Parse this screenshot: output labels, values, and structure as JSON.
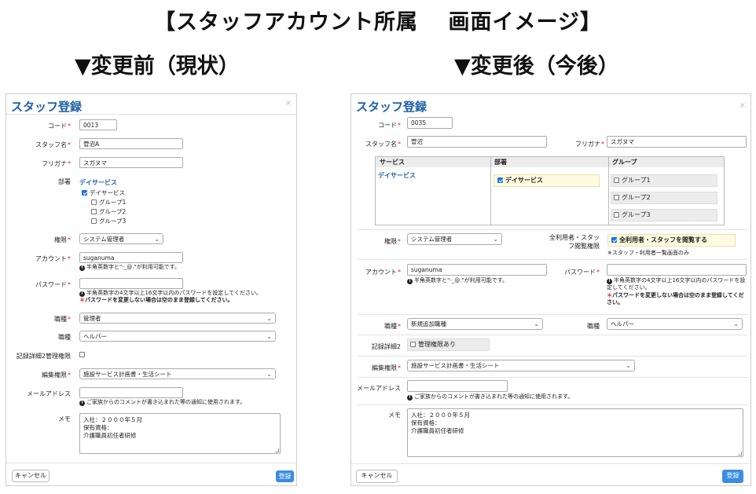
{
  "heading": {
    "title": "【スタッフアカウント所属　 画面イメージ】",
    "before": "▼変更前（現状）",
    "after": "▼変更後（今後）"
  },
  "required_mark": "*",
  "before": {
    "title": "スタッフ登録",
    "close": "×",
    "code_label": "コード",
    "code_value": "0013",
    "name_label": "スタッフ名",
    "name_value": "菅沼A",
    "kana_label": "フリガナ",
    "kana_value": "スガヌマ",
    "dept_label": "部署",
    "dept_link": "デイサービス",
    "dept_check": "デイサービス",
    "groups": [
      "グループ1",
      "グループ2",
      "グループ3"
    ],
    "authority_label": "権限",
    "authority_value": "システム管理者",
    "account_label": "アカウント",
    "account_value": "suganuma",
    "account_note": "半角英数字と\"-_@.\"が利用可能です。",
    "password_label": "パスワード",
    "password_note": "半角英数字の4文字以上16文字以内のパスワードを設定してください。",
    "password_warn": "パスワードを変更しない場合は空のまま登録してください。",
    "job_label": "職種",
    "job_value": "管理者",
    "job2_label": "職種",
    "job2_value": "ヘルパー",
    "record_label": "記録詳細2管理権限",
    "edit_label": "編集権限",
    "edit_value": "施設サービス計画書・生活シート",
    "mail_label": "メールアドレス",
    "mail_note": "ご家族からのコメントが書き込まれた等の通知に使用されます。",
    "memo_label": "メモ",
    "memo_lines": [
      "入社：２０００年５月",
      "保有資格：",
      "介護職員初任者研修"
    ],
    "cancel": "キャンセル",
    "submit": "登録"
  },
  "after": {
    "title": "スタッフ登録",
    "close": "×",
    "code_label": "コード",
    "code_value": "0035",
    "name_label": "スタッフ名",
    "name_value": "菅沼",
    "kana_label": "フリガナ",
    "kana_value": "スガヌマ",
    "table_headers": [
      "サービス",
      "部署",
      "グループ"
    ],
    "service_link": "デイサービス",
    "dept_check": "デイサービス",
    "groups": [
      "グループ1",
      "グループ2",
      "グループ3"
    ],
    "authority_label": "権限",
    "authority_value": "システム管理者",
    "all_users_label": "全利用者・スタッフ閲覧権限",
    "all_users_check": "全利用者・スタッフを閲覧する",
    "all_users_note": "※スタッフ・利用者一覧画面のみ",
    "account_label": "アカウント",
    "account_value": "suganuma",
    "account_note": "半角英数字と\"-_@.\"が利用可能です。",
    "password_label": "パスワード",
    "password_note": "半角英数字の4文字以上16文字以内のパスワードを設定してください。",
    "password_warn": "パスワードを変更しない場合は空のまま登録してください。",
    "job_label": "職種",
    "job_value": "新規追加職種",
    "job2_label": "職種",
    "job2_value": "ヘルパー",
    "record_label": "記録詳細2",
    "record_check": "管理権限あり",
    "edit_label": "編集権限",
    "edit_value": "施設サービス計画書・生活シート",
    "mail_label": "メールアドレス",
    "mail_note": "ご家族からのコメントが書き込まれた等の通知に使用されます。",
    "memo_label": "メモ",
    "memo_lines": [
      "入社：２０００年５月",
      "保有資格：",
      "介護職員初任者研修"
    ],
    "cancel": "キャンセル",
    "submit": "登録"
  }
}
